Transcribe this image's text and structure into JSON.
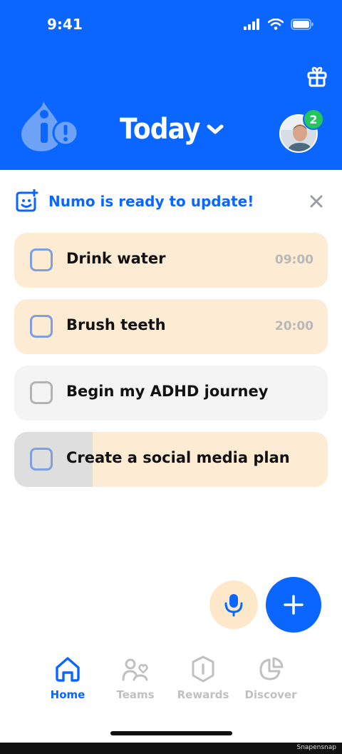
{
  "status_bar": {
    "time": "9:41"
  },
  "header": {
    "title": "Today",
    "notification_count": "2",
    "colors": {
      "background": "#0a66ff",
      "badge": "#22c55e"
    }
  },
  "banner": {
    "text": "Numo is ready to update!"
  },
  "tasks": [
    {
      "label": "Drink water",
      "time": "09:00",
      "bg": "#fdebd3",
      "progress": 0
    },
    {
      "label": "Brush teeth",
      "time": "20:00",
      "bg": "#fdebd3",
      "progress": 0
    },
    {
      "label": "Begin my ADHD journey",
      "time": "",
      "bg": "#f4f4f4",
      "progress": 0
    },
    {
      "label": "Create a social media plan",
      "time": "",
      "bg": "#fdebd3",
      "progress": 0.25
    }
  ],
  "nav": {
    "items": [
      {
        "label": "Home",
        "icon": "home-icon",
        "active": true
      },
      {
        "label": "Teams",
        "icon": "teams-icon",
        "active": false
      },
      {
        "label": "Rewards",
        "icon": "rewards-icon",
        "active": false
      },
      {
        "label": "Discover",
        "icon": "discover-icon",
        "active": false
      }
    ]
  },
  "watermark": "Snapensnap"
}
